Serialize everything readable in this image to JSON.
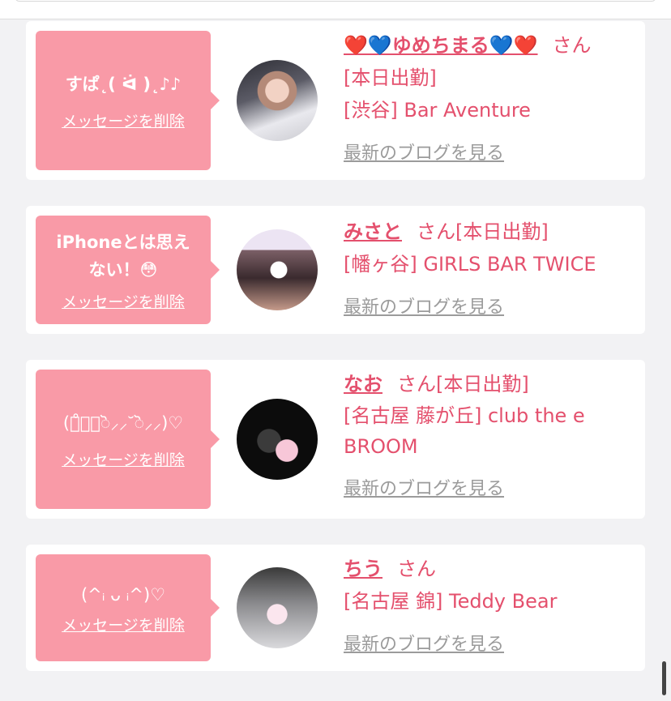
{
  "colors": {
    "accent": "#e4506d",
    "bubble": "#f99aa7",
    "background": "#f2f2f4",
    "link_gray": "#9b9b9b"
  },
  "cards": [
    {
      "message": "すぱ˛( ᐛ )˛♪♪",
      "delete_label": "メッセージを削除",
      "name": "❤️💙ゆめちまる💙❤️",
      "honorific": "さん",
      "lines": [
        "[本日出勤]",
        "[渋谷] Bar Aventure"
      ],
      "blog_label": "最新のブログを見る"
    },
    {
      "message": "iPhoneとは思えない！😳",
      "delete_label": "メッセージを削除",
      "name": "みさと",
      "honorific": "さん[本日出勤]",
      "lines": [
        "[幡ヶ谷] GIRLS BAR TWICE"
      ],
      "blog_label": "最新のブログを見る"
    },
    {
      "message": "(ง̊⸝⸝ॆ⸝⸝˘ॆ⸝⸝)♡",
      "delete_label": "メッセージを削除",
      "name": "なお",
      "honorific": "さん[本日出勤]",
      "lines": [
        "[名古屋 藤が丘] club the e BROOM"
      ],
      "blog_label": "最新のブログを見る"
    },
    {
      "message": "(^ᵢ ᴗ ᵢ^)♡",
      "delete_label": "メッセージを削除",
      "name": "ちう",
      "honorific": "さん",
      "lines": [
        "[名古屋 錦] Teddy Bear"
      ],
      "blog_label": "最新のブログを見る"
    }
  ]
}
